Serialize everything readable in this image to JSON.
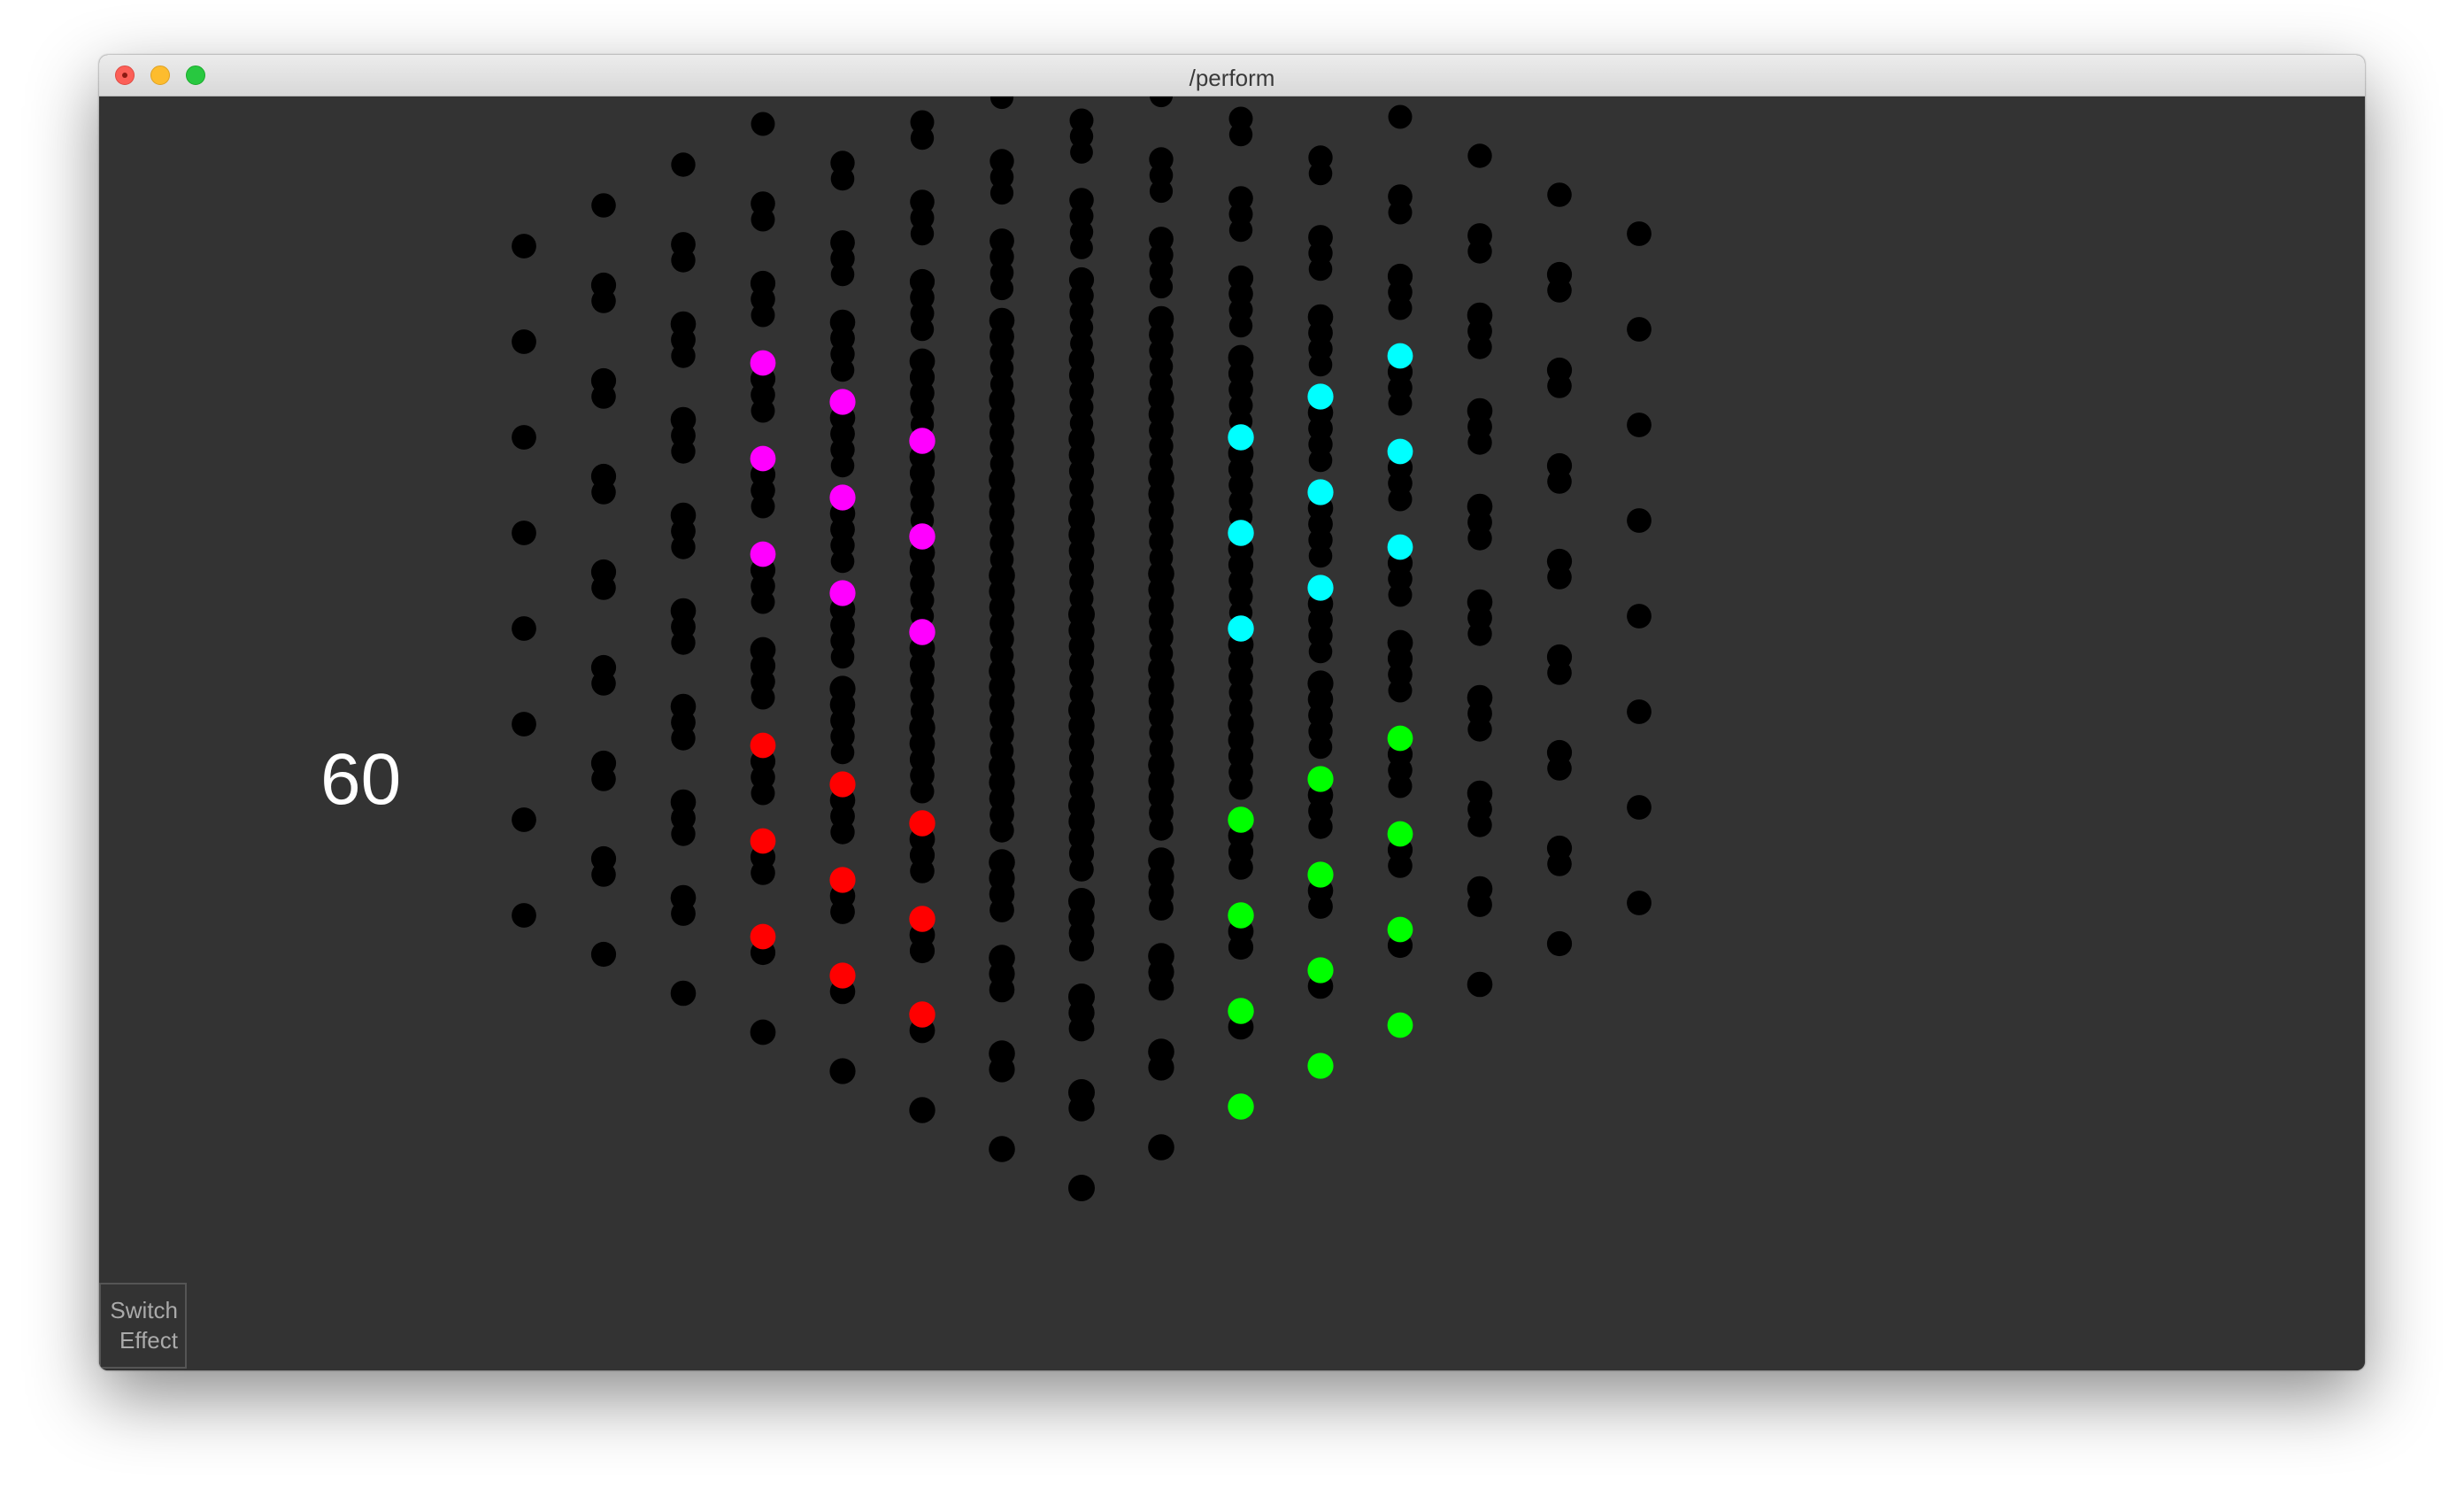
{
  "window": {
    "title": "/perform"
  },
  "hud": {
    "fps_value": "60"
  },
  "controls": {
    "switch_effect_line1": "Switch",
    "switch_effect_line2": "Effect"
  },
  "scene": {
    "description_kind": "3D dot cube animation",
    "grid_size": 8,
    "background_color": "#333333",
    "dot_colors": {
      "default": "#000000",
      "cyan": "#00ffff",
      "magenta": "#ff00ff",
      "green": "#00ff00",
      "red": "#ff0000"
    }
  },
  "colors": {
    "canvas": "#333333",
    "titlebar": "#e3e3e3",
    "fps_text": "#ffffff"
  }
}
